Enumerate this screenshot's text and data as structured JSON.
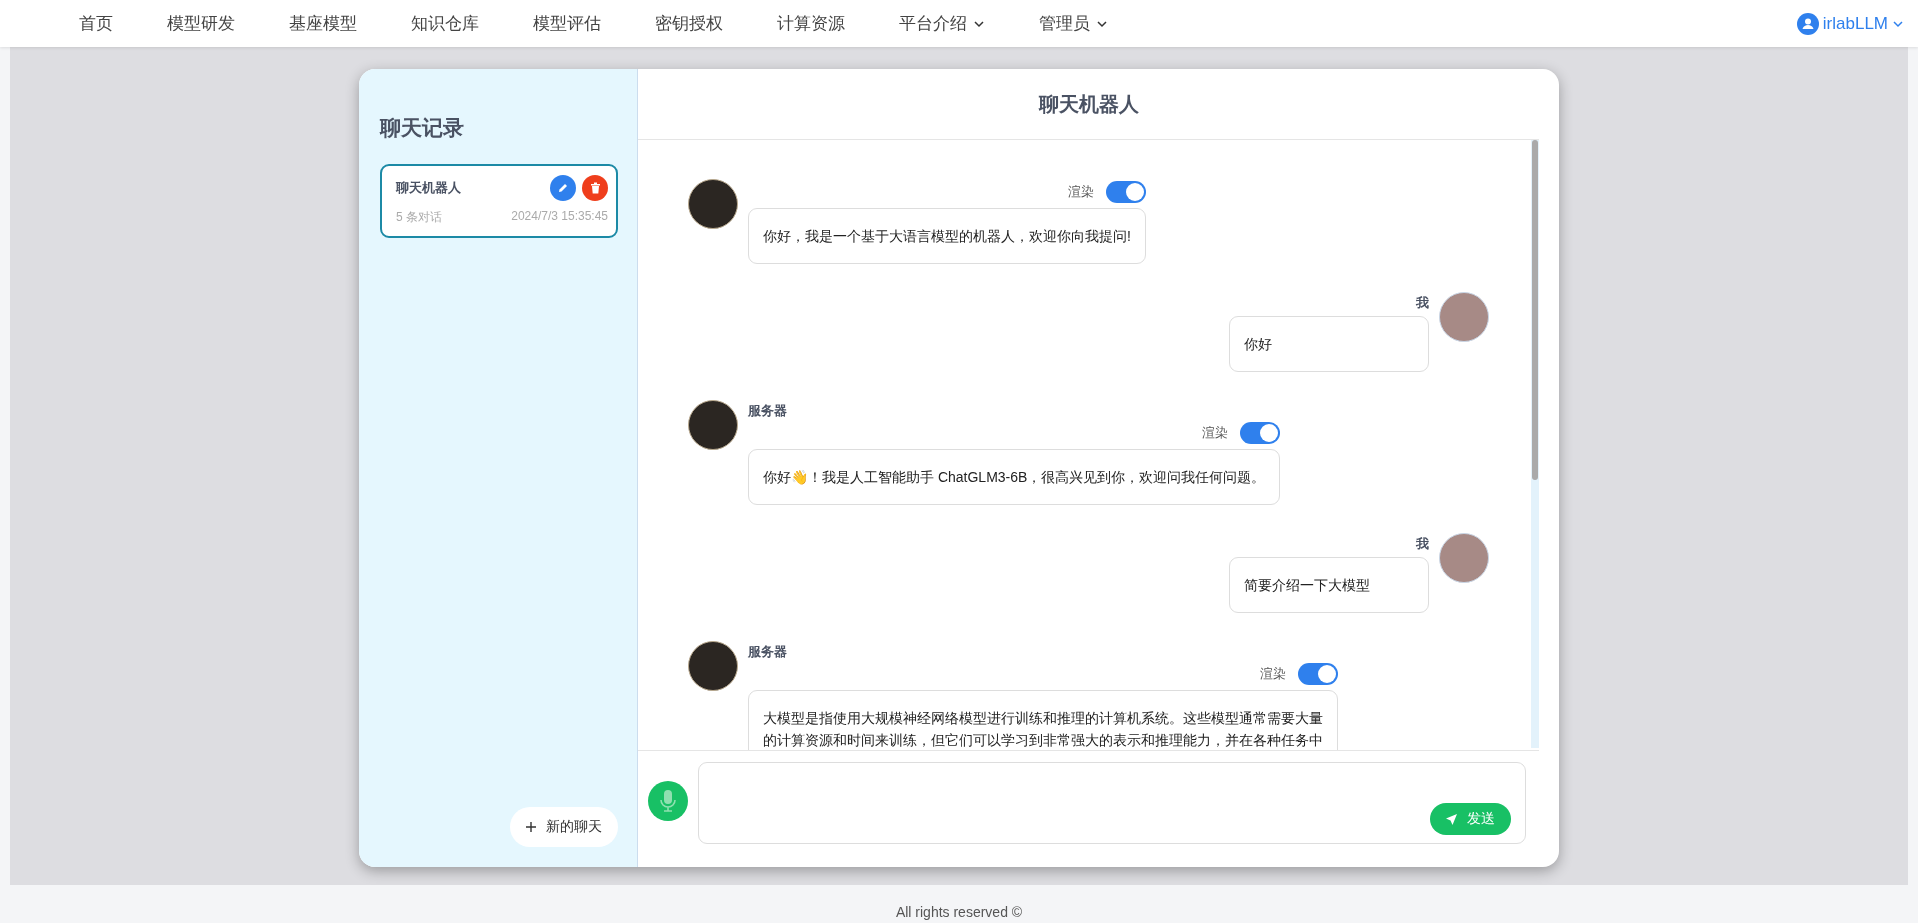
{
  "nav": {
    "items": [
      {
        "label": "首页",
        "dropdown": false
      },
      {
        "label": "模型研发",
        "dropdown": false
      },
      {
        "label": "基座模型",
        "dropdown": false
      },
      {
        "label": "知识仓库",
        "dropdown": false
      },
      {
        "label": "模型评估",
        "dropdown": false
      },
      {
        "label": "密钥授权",
        "dropdown": false
      },
      {
        "label": "计算资源",
        "dropdown": false
      },
      {
        "label": "平台介绍",
        "dropdown": true
      },
      {
        "label": "管理员",
        "dropdown": true
      }
    ],
    "user": "irlabLLM"
  },
  "sidebar": {
    "title": "聊天记录",
    "sessions": [
      {
        "name": "聊天机器人",
        "count": "5 条对话",
        "time": "2024/7/3 15:35:45",
        "selected": true
      }
    ],
    "new_chat": "新的聊天"
  },
  "chat": {
    "title": "聊天机器人",
    "messages": [
      {
        "kind": "bot",
        "render_label": "渲染",
        "render_on": true,
        "text": "你好，我是一个基于大语言模型的机器人，欢迎你向我提问!"
      },
      {
        "kind": "user",
        "sender": "我",
        "text": "你好"
      },
      {
        "kind": "bot",
        "sender": "服务器",
        "render_label": "渲染",
        "render_on": true,
        "text": "你好👋！我是人工智能助手 ChatGLM3-6B，很高兴见到你，欢迎问我任何问题。"
      },
      {
        "kind": "user",
        "sender": "我",
        "text": "简要介绍一下大模型"
      },
      {
        "kind": "bot",
        "sender": "服务器",
        "render_label": "渲染",
        "render_on": true,
        "text": "大模型是指使用大规模神经网络模型进行训练和推理的计算机系统。这些模型通常需要大量的计算资源和时间来训练，但它们可以学习到非常强大的表示和推理能力，并在各种任务中"
      }
    ],
    "send": "发送"
  },
  "footer": "All rights reserved ©"
}
